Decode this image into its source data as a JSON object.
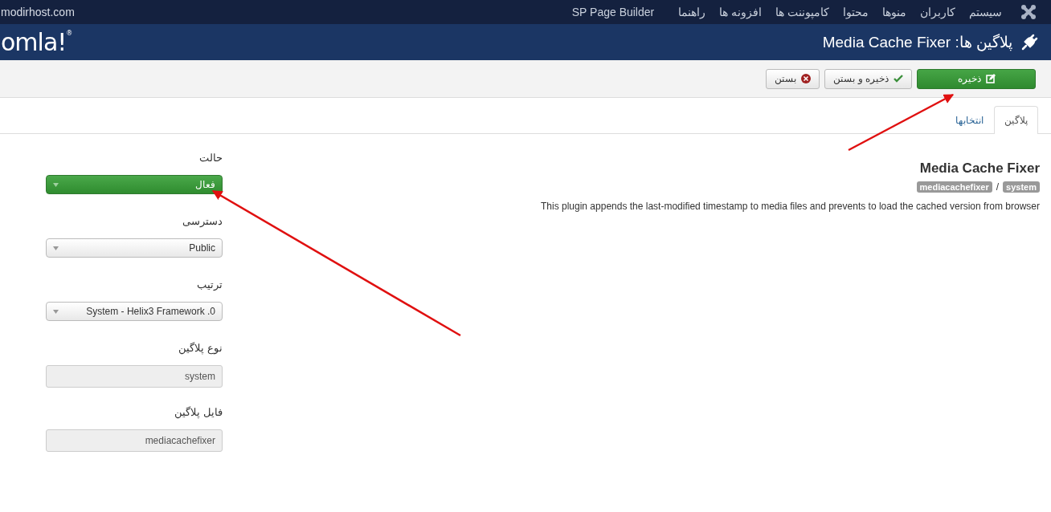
{
  "top_menu": {
    "items": [
      "سیستم",
      "کاربران",
      "منوها",
      "محتوا",
      "کامپوننت ها",
      "افزونه ها",
      "راهنما"
    ],
    "extension": "SP Page Builder",
    "site": "modirhost.com"
  },
  "header": {
    "title": "پلاگین ها: Media Cache Fixer",
    "logo": "omla!",
    "logo_mark": "®"
  },
  "toolbar": {
    "buttons": [
      {
        "kind": "save",
        "label": "ذخیره"
      },
      {
        "kind": "save_close",
        "label": "ذخیره و بستن"
      },
      {
        "kind": "close",
        "label": "بستن"
      }
    ]
  },
  "tabs": [
    {
      "label": "پلاگین",
      "selected": true
    },
    {
      "label": "انتخابها",
      "selected": false
    }
  ],
  "plugin": {
    "name": "Media Cache Fixer",
    "badges": [
      "system",
      "mediacachefixer"
    ],
    "separator": "/",
    "description": "This plugin appends the last-modified timestamp to media files and prevents to load the cached version from browser"
  },
  "fields": [
    {
      "label": "حالت",
      "kind": "select",
      "value": "فعال",
      "highlighted": true
    },
    {
      "label": "دسترسی",
      "kind": "select",
      "value": "Public",
      "highlighted": false
    },
    {
      "label": "ترتیب",
      "kind": "select",
      "value": "0. System - Helix3 Framework",
      "highlighted": false
    },
    {
      "label": "نوع پلاگین",
      "kind": "readonly",
      "value": "system"
    },
    {
      "label": "فایل پلاگین",
      "kind": "readonly",
      "value": "mediacachefixer"
    }
  ]
}
